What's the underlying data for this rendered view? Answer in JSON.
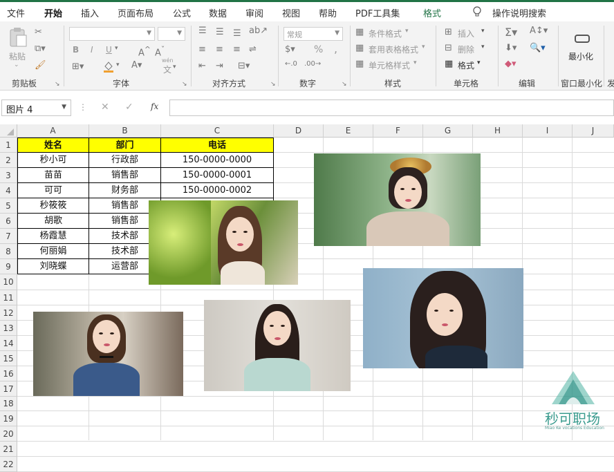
{
  "ribbon_tabs": [
    "文件",
    "开始",
    "插入",
    "页面布局",
    "公式",
    "数据",
    "审阅",
    "视图",
    "帮助",
    "PDF工具集",
    "格式"
  ],
  "tell_me": "操作说明搜索",
  "clipboard": {
    "paste": "粘贴",
    "label": "剪贴板"
  },
  "font": {
    "label": "字体",
    "bold": "B",
    "italic": "I",
    "underline": "U",
    "wen": "wén",
    "wen_char": "文"
  },
  "alignment": {
    "label": "对齐方式"
  },
  "number": {
    "format": "常规",
    "label": "数字",
    "percent": "%",
    "comma": ","
  },
  "styles": {
    "cond": "条件格式",
    "table": "套用表格格式",
    "cell": "单元格样式",
    "label": "样式"
  },
  "cells": {
    "insert": "插入",
    "delete": "删除",
    "format": "格式",
    "label": "单元格"
  },
  "editing": {
    "label": "编辑"
  },
  "minimize": {
    "btn": "最小化",
    "label": "窗口最小化",
    "next": "发"
  },
  "formula_bar": {
    "name_box": "图片 4",
    "fx": "fx",
    "cancel": "✕",
    "confirm": "✓",
    "value": ""
  },
  "columns": [
    "A",
    "B",
    "C",
    "D",
    "E",
    "F",
    "G",
    "H",
    "I",
    "J"
  ],
  "rows": [
    "1",
    "2",
    "3",
    "4",
    "5",
    "6",
    "7",
    "8",
    "9",
    "10",
    "11",
    "12",
    "13",
    "14",
    "15",
    "16",
    "17",
    "18",
    "19",
    "20",
    "21",
    "22"
  ],
  "table": {
    "headers": [
      "姓名",
      "部门",
      "电话"
    ],
    "rows": [
      [
        "秒小可",
        "行政部",
        "150-0000-0000"
      ],
      [
        "苗苗",
        "销售部",
        "150-0000-0001"
      ],
      [
        "可可",
        "财务部",
        "150-0000-0002"
      ],
      [
        "秒筱筱",
        "销售部",
        ""
      ],
      [
        "胡歌",
        "销售部",
        ""
      ],
      [
        "杨霞慧",
        "技术部",
        ""
      ],
      [
        "何丽娟",
        "技术部",
        ""
      ],
      [
        "刘晓蝶",
        "运营部",
        ""
      ]
    ]
  },
  "watermark": {
    "brand": "秒可职场",
    "sub": "Miao Ke vocations Education"
  },
  "colors": {
    "accent": "#217346",
    "header_fill": "#ffff00",
    "watermark": "#3a9b8e"
  }
}
